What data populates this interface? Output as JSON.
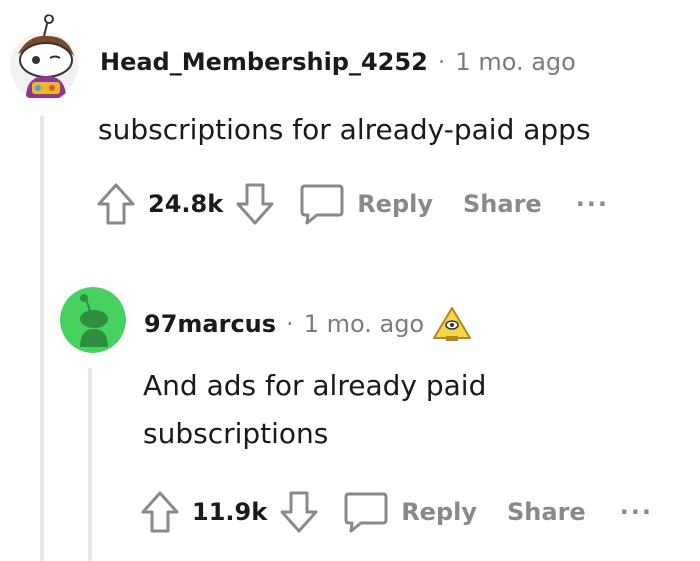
{
  "comments": [
    {
      "username": "Head_Membership_4252",
      "separator": "·",
      "time": "1 mo. ago",
      "body": "subscriptions for already-paid apps",
      "score": "24.8k",
      "reply_label": "Reply",
      "share_label": "Share",
      "more_label": "···"
    },
    {
      "username": "97marcus",
      "separator": "·",
      "time": "1 mo. ago",
      "body": "And ads for already paid\nsubscriptions",
      "score": "11.9k",
      "reply_label": "Reply",
      "share_label": "Share",
      "more_label": "···"
    }
  ],
  "colors": {
    "muted": "#878a8c",
    "thread_line": "#e6e8ea",
    "avatar_green": "#46d160"
  },
  "icons": [
    "upvote-icon",
    "downvote-icon",
    "speech-bubble-icon",
    "award-icon"
  ]
}
